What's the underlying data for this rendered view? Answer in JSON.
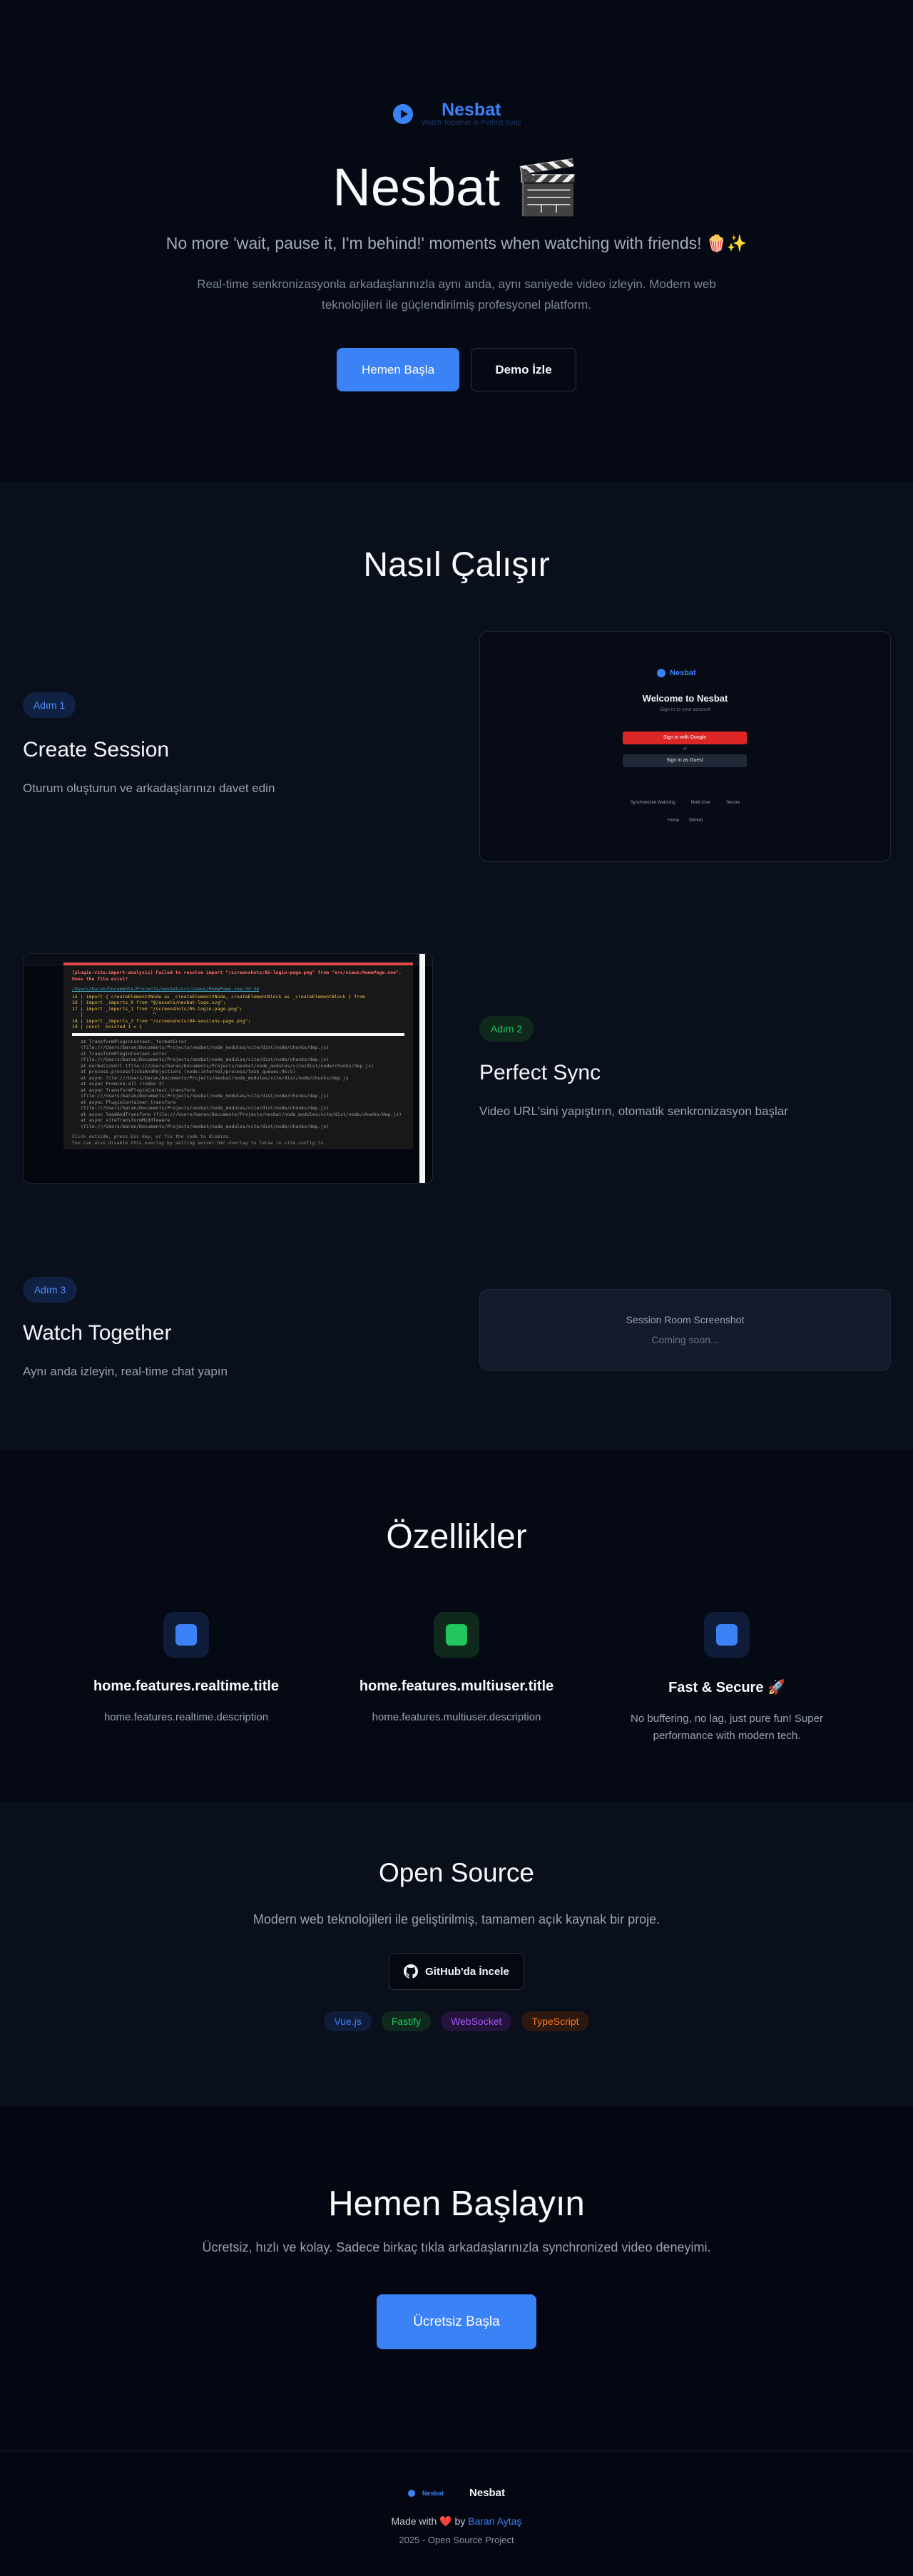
{
  "hero": {
    "brand_name": "Nesbat",
    "brand_tagline": "Watch Together in Perfect Sync",
    "title": "Nesbat 🎬",
    "subtitle": "No more 'wait, pause it, I'm behind!' moments when watching with friends! 🍿✨",
    "description": "Real-time senkronizasyonla arkadaşlarınızla aynı anda, aynı saniyede video izleyin. Modern web teknolojileri ile güçlendirilmiş profesyonel platform.",
    "start_button": "Hemen Başla",
    "demo_button": "Demo İzle"
  },
  "how": {
    "title": "Nasıl Çalışır",
    "steps": [
      {
        "badge": "Adım 1",
        "title": "Create Session",
        "description": "Oturum oluşturun ve arkadaşlarınızı davet edin"
      },
      {
        "badge": "Adım 2",
        "title": "Perfect Sync",
        "description": "Video URL'sini yapıştırın, otomatik senkronizasyon başlar"
      },
      {
        "badge": "Adım 3",
        "title": "Watch Together",
        "description": "Aynı anda izleyin, real-time chat yapın"
      }
    ],
    "login_mock": {
      "brand": "Nesbat",
      "welcome": "Welcome to Nesbat",
      "signin_text": "Sign in to your account",
      "google_button": "Sign in with Google",
      "or_text": "or",
      "guest_button": "Sign in as Guest",
      "features": [
        "Synchronized Watching",
        "Multi-User",
        "Secure"
      ],
      "links": [
        "Home",
        "GitHub"
      ]
    },
    "error_mock": {
      "title": "[plugin:vite:import-analysis] Failed to resolve import \"/screenshots/05-login-page.png\" from \"src/views/HomePage.vue\". Does the file exist?",
      "file": "/Users/baran/Documents/Projects/nesbat/src/views/HomePage.vue:33:34",
      "code": [
        "15 |  import { createElementVNode as _createElementVNode, createElementBlock as _createElementBlock } from",
        "16 |  import _imports_0 from \"@/assets/nesbat-logo.svg\";",
        "17 |  import _imports_1 from \"/screenshots/05-login-page.png\";",
        "   |                         ^",
        "18 |  import _imports_2 from \"/screenshots/04-sessions-page.png\";",
        "19 |  const _hoisted_1 = {"
      ],
      "stack": [
        "at TransformPluginContext._formatError (file:///Users/baran/Documents/Projects/nesbat/node_modules/vite/dist/node/chunks/dep.js)",
        "at TransformPluginContext.error (file:///Users/baran/Documents/Projects/nesbat/node_modules/vite/dist/node/chunks/dep.js)",
        "at normalizeUrl (file:///Users/baran/Documents/Projects/nesbat/node_modules/vite/dist/node/chunks/dep.js)",
        "at process.processTicksAndRejections (node:internal/process/task_queues:95:5)",
        "at async file:///Users/baran/Documents/Projects/nesbat/node_modules/vite/dist/node/chunks/dep.js",
        "at async Promise.all (index 3)",
        "at async TransformPluginContext.transform (file:///Users/baran/Documents/Projects/nesbat/node_modules/vite/dist/node/chunks/dep.js)",
        "at async PluginContainer.transform (file:///Users/baran/Documents/Projects/nesbat/node_modules/vite/dist/node/chunks/dep.js)",
        "at async loadAndTransform (file:///Users/baran/Documents/Projects/nesbat/node_modules/vite/dist/node/chunks/dep.js)",
        "at async viteTransformMiddleware (file:///Users/baran/Documents/Projects/nesbat/node_modules/vite/dist/node/chunks/dep.js)"
      ],
      "footer": "Click outside, press Esc key, or fix the code to dismiss.\nYou can also disable this overlay by setting server.hmr.overlay to false in vite.config.ts."
    },
    "session_mock": {
      "title": "Session Room Screenshot",
      "subtitle": "Coming soon..."
    }
  },
  "features": {
    "title": "Özellikler",
    "items": [
      {
        "title": "home.features.realtime.title",
        "description": "home.features.realtime.description",
        "color": "#3b82f6"
      },
      {
        "title": "home.features.multiuser.title",
        "description": "home.features.multiuser.description",
        "color": "#22c55e"
      },
      {
        "title": "Fast & Secure 🚀",
        "description": "No buffering, no lag, just pure fun! Super performance with modern tech.",
        "color": "#3b82f6"
      }
    ]
  },
  "open_source": {
    "title": "Open Source",
    "description": "Modern web teknolojileri ile geliştirilmiş, tamamen açık kaynak bir proje.",
    "github_button": "GitHub'da İncele",
    "tags": [
      {
        "label": "Vue.js",
        "color": "#3b82f6"
      },
      {
        "label": "Fastify",
        "color": "#22c55e"
      },
      {
        "label": "WebSocket",
        "color": "#a855f7"
      },
      {
        "label": "TypeScript",
        "color": "#f97316"
      }
    ]
  },
  "cta": {
    "title": "Hemen Başlayın",
    "description": "Ücretsiz, hızlı ve kolay. Sadece birkaç tıkla arkadaşlarınızla synchronized video deneyimi.",
    "button": "Ücretsiz Başla"
  },
  "footer": {
    "small_brand": "Nesbat",
    "brand": "Nesbat",
    "made_with": "Made with",
    "heart": "❤️",
    "by": "by",
    "author": "Baran Aytaş",
    "copyright": "2025 - Open Source Project"
  }
}
